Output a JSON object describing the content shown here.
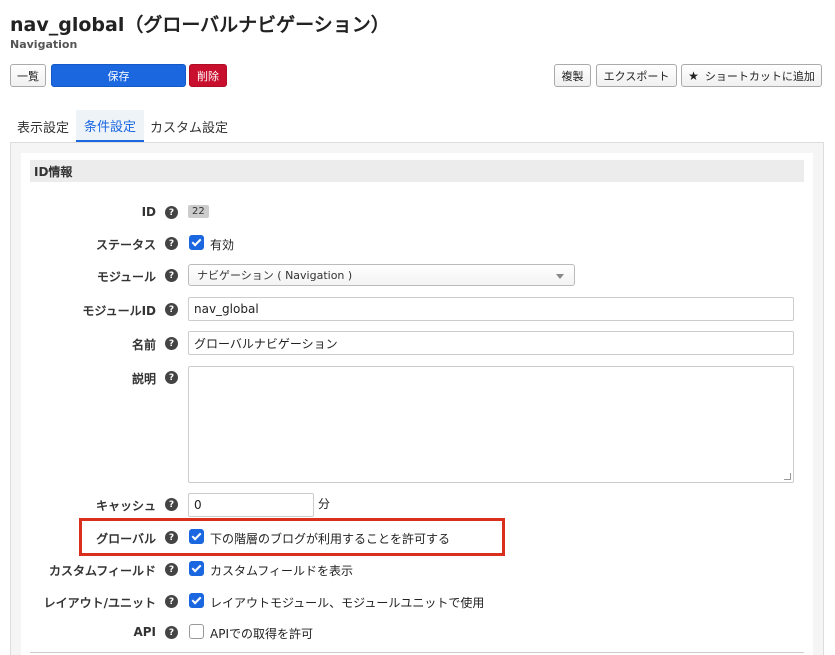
{
  "header": {
    "title": "nav_global（グローバルナビゲーション）",
    "subtitle": "Navigation"
  },
  "toolbar": {
    "list_label": "一覧",
    "save_label": "保存",
    "delete_label": "削除",
    "duplicate_label": "複製",
    "export_label": "エクスポート",
    "shortcut_label": "ショートカットに追加",
    "shortcut_icon": "star-icon"
  },
  "tabs": [
    {
      "label": "表示設定",
      "active": false
    },
    {
      "label": "条件設定",
      "active": true
    },
    {
      "label": "カスタム設定",
      "active": false
    }
  ],
  "section": {
    "title": "ID情報"
  },
  "help_glyph": "?",
  "fields": {
    "id": {
      "label": "ID",
      "value": "22"
    },
    "status": {
      "label": "ステータス",
      "checkbox_label": "有効",
      "checked": true
    },
    "module": {
      "label": "モジュール",
      "selected": "ナビゲーション ( Navigation )"
    },
    "module_id": {
      "label": "モジュールID",
      "value": "nav_global"
    },
    "name": {
      "label": "名前",
      "value": "グローバルナビゲーション"
    },
    "description": {
      "label": "説明",
      "value": ""
    },
    "cache": {
      "label": "キャッシュ",
      "value": "0",
      "unit": "分"
    },
    "global": {
      "label": "グローバル",
      "checkbox_label": "下の階層のブログが利用することを許可する",
      "checked": true
    },
    "custom_field": {
      "label": "カスタムフィールド",
      "checkbox_label": "カスタムフィールドを表示",
      "checked": true
    },
    "layout_unit": {
      "label": "レイアウト/ユニット",
      "checkbox_label": "レイアウトモジュール、モジュールユニットで使用",
      "checked": true
    },
    "api": {
      "label": "API",
      "checkbox_label": "APIでの取得を許可",
      "checked": false
    }
  },
  "colors": {
    "primary": "#1a67e0",
    "danger": "#c8102e",
    "highlight": "#d9301e"
  }
}
